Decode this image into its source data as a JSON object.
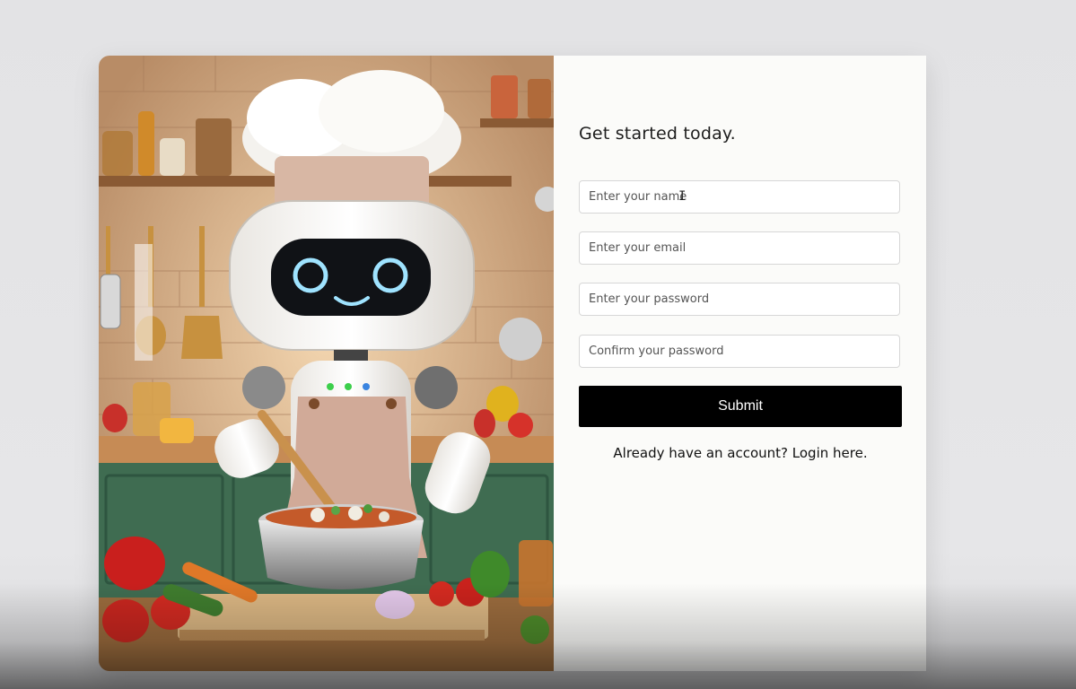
{
  "illustration": {
    "alt": "Robot chef cooking in a kitchen"
  },
  "signup_form": {
    "title": "Get started today.",
    "name_placeholder": "Enter your name",
    "email_placeholder": "Enter your email",
    "password_placeholder": "Enter your password",
    "confirm_password_placeholder": "Confirm your password",
    "submit_label": "Submit",
    "login_prompt": "Already have an account? Login here."
  }
}
